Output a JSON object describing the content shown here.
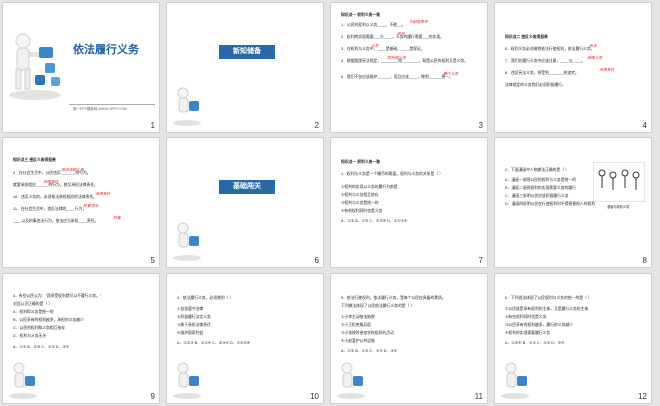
{
  "slides": [
    {
      "num": "1",
      "title": "依法履行义务",
      "footer": "第一PPT模板网-WWW.1PPT.COM"
    },
    {
      "num": "2",
      "banner": "新知储备"
    },
    {
      "num": "3",
      "heading": "知识点一  权利义务一致",
      "lines": [
        "1．公民的权利以义务____，不能__。",
        "2．权利的实现需要___与____，义务的履行需要___的实现。",
        "3．在权利与义务中，____是基础，____是保证。",
        "4．根据我国宪法规定，________和________，既是公民的权利又是义务。",
        "5．我们不仅应该维护______，而且应该____，做到______统一。"
      ],
      "answers": [
        "为前提条件",
        "权利",
        "义务",
        "权利和义务",
        "履行义务"
      ]
    },
    {
      "num": "4",
      "heading": "知识点二  违反义务须担责",
      "lines": [
        "6．权利义务必须做到依法行使权利，依法履行义务。",
        "7．我们在履行义务中应该注意，____与____。",
        "8．违反宪法义务，将受到_______的追究。",
        "法律规定的义务我们必须积极履行。"
      ],
      "answers": [
        "合法",
        "道德义务",
        "法律责任"
      ]
    },
    {
      "num": "5",
      "heading": "知识点三  违反义务须担责",
      "lines": [
        "9．在社会生活中，公民违反_______的行为，",
        "就要承担相应______的行为，甚至承担法律责任。",
        "10．违反义务的，必须依法承担相应的法律责任。",
        "11．在社会生活中，违反法律的____行为，",
        "____以及刑事违法行为，依法应当承担____责任。"
      ],
      "answers": [
        "违法违规义务",
        "法律责任",
        "法律责任",
        "民事违法",
        "刑事"
      ]
    },
    {
      "num": "6",
      "banner": "基础闯关"
    },
    {
      "num": "7",
      "heading": "知识点一  权利义务一致",
      "lines": [
        "1．权利与义务是一个硬币的两面。权利与义务的关系是（  ）",
        "①权利的实现以义务的履行为前提",
        "②权利与义务相互依存",
        "③权利与义务是统一的",
        "④有的权利同时也是义务",
        "A．①②   B．①③   C．②③④   D．①②③④"
      ]
    },
    {
      "num": "8",
      "lines": [
        "2．下面漫画中人物做法正确的是（  ）",
        "A．漫画一说明公民的权利与义务是统一的",
        "B．漫画二说明权利的实现需要义务的履行",
        "C．漫画三说明公民应该积极履行义务",
        "D．漫画四说明公民在行使权利时不得损害他人的权利"
      ],
      "caption": "漫画与权利义务"
    },
    {
      "num": "9",
      "lines": [
        "3．有些公民认为：“我享受权利就可以不履行义务。”",
        "对此认识正确的是（  ）",
        "A．权利和义务是统一的",
        "B．公民享有的权利越多，承担的义务越少",
        "C．公民的权利和义务相互依存",
        "D．权利与义务无关",
        "A．①②   B．②③   C．①③   D．③④"
      ]
    },
    {
      "num": "10",
      "lines": [
        "4．依法履行义务，必须做到（  ）",
        "①自觉遵守法律",
        "②积极履行法定义务",
        "③勇于承担法律责任",
        "④维护国家利益",
        "A．①②③   B．①②④   C．②③④   D．①②③④"
      ]
    },
    {
      "num": "11",
      "lines": [
        "5．依法行使权利，依法履行义务，是每个公民应具备的素质。",
        "下列做法体现了公民依法履行义务的是（  ）",
        "①小李主动依法纳税",
        "②小王拒绝服兵役",
        "③小张按时参加学校组织的活动",
        "④小赵爱护公共设施",
        "A．①②   B．①③   C．①④   D．③④"
      ]
    },
    {
      "num": "12",
      "lines": [
        "6．下列说法体现了公民权利与义务的统一的是（  ）",
        "①公民既是享有权利的主体，又是履行义务的主体",
        "②有些权利同时也是义务",
        "③公民享有的权利越多，履行的义务越少",
        "④权利的实现需要履行义务",
        "A．①②④   B．①③   C．②③   D．③④"
      ]
    }
  ]
}
